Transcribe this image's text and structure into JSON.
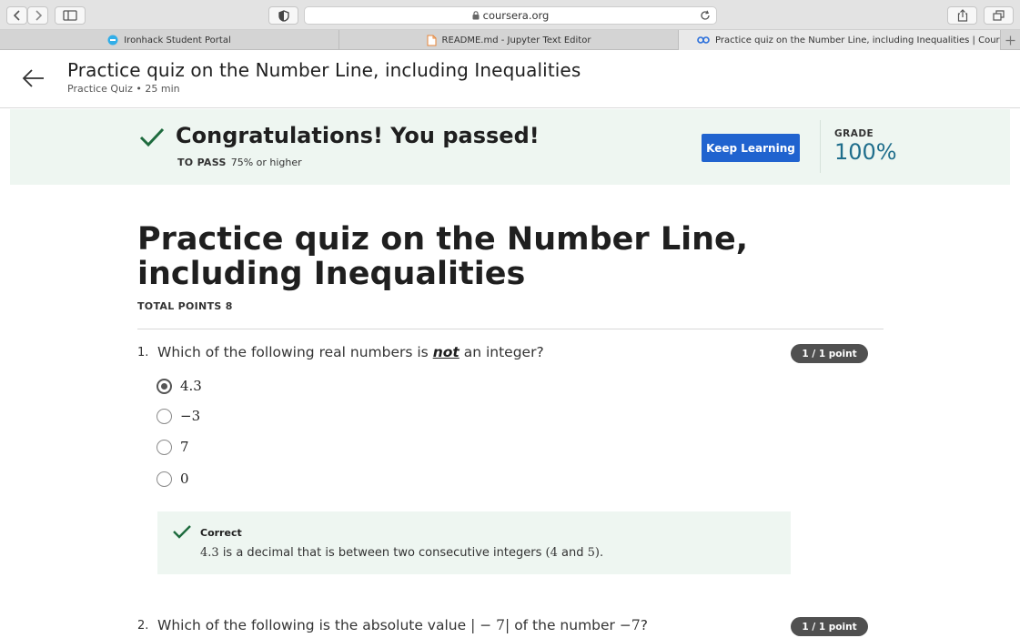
{
  "browser": {
    "url": "coursera.org",
    "tabs": [
      {
        "label": "Ironhack Student Portal"
      },
      {
        "label": "README.md - Jupyter Text Editor"
      },
      {
        "label": "Practice quiz on the Number Line, including Inequalities | Cours..."
      }
    ]
  },
  "header": {
    "title": "Practice quiz on the Number Line, including Inequalities",
    "subtitle": "Practice Quiz • 25 min"
  },
  "banner": {
    "message": "Congratulations! You passed!",
    "to_pass_label": "TO PASS",
    "to_pass_value": "75% or higher",
    "keep_learning_label": "Keep Learning",
    "grade_label": "GRADE",
    "grade_value": "100%",
    "accent_color": "#2063cf"
  },
  "quiz": {
    "title": "Practice quiz on the Number Line, including Inequalities",
    "total_points": "TOTAL POINTS 8",
    "questions": [
      {
        "number": "1.",
        "text_pre": "Which of the following real numbers is",
        "text_em": "not",
        "text_post": "an integer?",
        "score": "1 / 1 point",
        "options": [
          {
            "label": "4.3",
            "selected": true
          },
          {
            "label": "−3",
            "selected": false
          },
          {
            "label": "7",
            "selected": false
          },
          {
            "label": "0",
            "selected": false
          }
        ],
        "feedback": {
          "title": "Correct",
          "math1": "4.3",
          "text1": " is a decimal that is between two consecutive integers ",
          "math2": "(4",
          "text2": " and ",
          "math3": "5)",
          "text3": "."
        }
      },
      {
        "number": "2.",
        "text_pre": "Which of the following is the absolute value",
        "math1": "| − 7|",
        "text_mid": "of the number",
        "math2": "−7",
        "text_post": "?",
        "score": "1 / 1 point"
      }
    ]
  }
}
